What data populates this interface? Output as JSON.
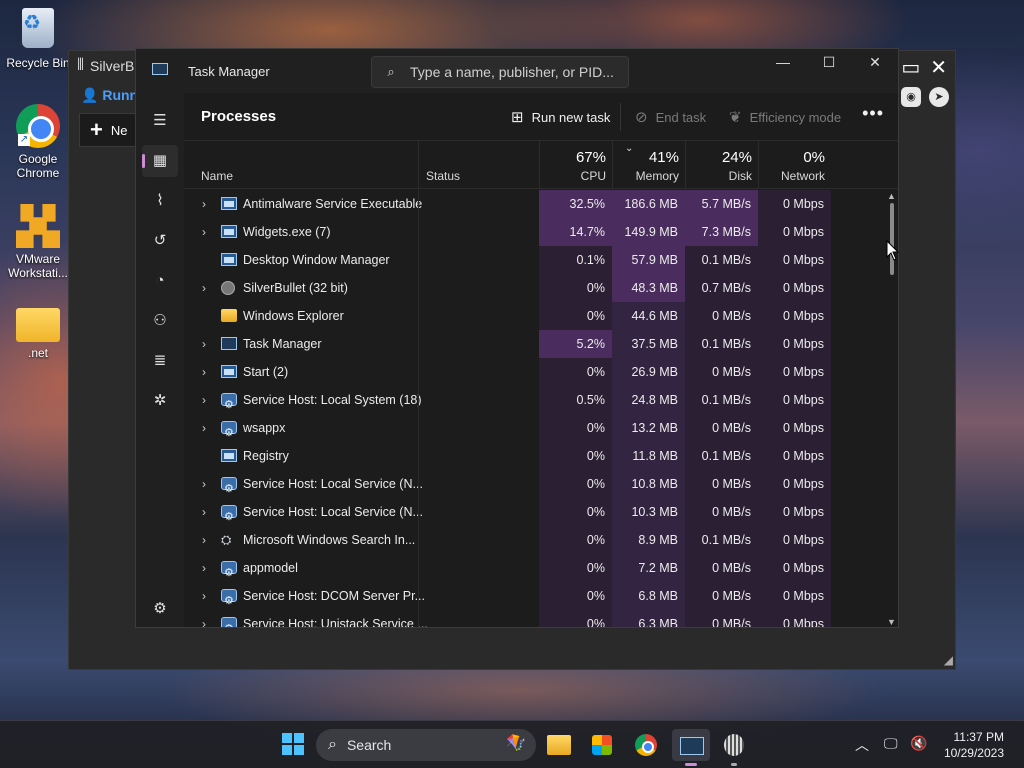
{
  "desktop": {
    "icons": [
      {
        "label": "Recycle Bin",
        "icon": "recycle-bin-icon"
      },
      {
        "label": "Google Chrome",
        "icon": "chrome-icon"
      },
      {
        "label": "VMware Workstati...",
        "icon": "vmware-icon"
      },
      {
        "label": ".net",
        "icon": "folder-icon"
      }
    ]
  },
  "background_window": {
    "title": "SilverB",
    "status_text": "Runn",
    "new_button": "Ne"
  },
  "task_manager": {
    "title": "Task Manager",
    "search_placeholder": "Type a name, publisher, or PID...",
    "page_title": "Processes",
    "commands": {
      "run_new_task": "Run new task",
      "end_task": "End task",
      "efficiency_mode": "Efficiency mode"
    },
    "columns": {
      "name": "Name",
      "status": "Status",
      "cpu": {
        "label": "CPU",
        "percent": "67%"
      },
      "memory": {
        "label": "Memory",
        "percent": "41%"
      },
      "disk": {
        "label": "Disk",
        "percent": "24%"
      },
      "network": {
        "label": "Network",
        "percent": "0%"
      }
    },
    "processes": [
      {
        "name": "Antimalware Service Executable",
        "expandable": true,
        "icon": "app-icon",
        "cpu": "32.5%",
        "memory": "186.6 MB",
        "disk": "5.7 MB/s",
        "network": "0 Mbps",
        "cpu_heat": 3,
        "mem_heat": 3,
        "disk_heat": 3
      },
      {
        "name": "Widgets.exe (7)",
        "expandable": true,
        "icon": "app-icon",
        "cpu": "14.7%",
        "memory": "149.9 MB",
        "disk": "7.3 MB/s",
        "network": "0 Mbps",
        "cpu_heat": 3,
        "mem_heat": 3,
        "disk_heat": 3
      },
      {
        "name": "Desktop Window Manager",
        "expandable": false,
        "icon": "app-icon",
        "cpu": "0.1%",
        "memory": "57.9 MB",
        "disk": "0.1 MB/s",
        "network": "0 Mbps",
        "cpu_heat": 1,
        "mem_heat": 3,
        "disk_heat": 1
      },
      {
        "name": "SilverBullet (32 bit)",
        "expandable": true,
        "icon": "silverbullet-icon",
        "cpu": "0%",
        "memory": "48.3 MB",
        "disk": "0.7 MB/s",
        "network": "0 Mbps",
        "cpu_heat": 1,
        "mem_heat": 3,
        "disk_heat": 1
      },
      {
        "name": "Windows Explorer",
        "expandable": false,
        "icon": "folder-icon",
        "cpu": "0%",
        "memory": "44.6 MB",
        "disk": "0 MB/s",
        "network": "0 Mbps",
        "cpu_heat": 1,
        "mem_heat": 2,
        "disk_heat": 1
      },
      {
        "name": "Task Manager",
        "expandable": true,
        "icon": "task-manager-icon",
        "cpu": "5.2%",
        "memory": "37.5 MB",
        "disk": "0.1 MB/s",
        "network": "0 Mbps",
        "cpu_heat": 3,
        "mem_heat": 2,
        "disk_heat": 1
      },
      {
        "name": "Start (2)",
        "expandable": true,
        "icon": "app-icon",
        "cpu": "0%",
        "memory": "26.9 MB",
        "disk": "0 MB/s",
        "network": "0 Mbps",
        "cpu_heat": 1,
        "mem_heat": 2,
        "disk_heat": 1
      },
      {
        "name": "Service Host: Local System (18)",
        "expandable": true,
        "icon": "gear-icon",
        "cpu": "0.5%",
        "memory": "24.8 MB",
        "disk": "0.1 MB/s",
        "network": "0 Mbps",
        "cpu_heat": 1,
        "mem_heat": 2,
        "disk_heat": 1
      },
      {
        "name": "wsappx",
        "expandable": true,
        "icon": "gear-icon",
        "cpu": "0%",
        "memory": "13.2 MB",
        "disk": "0 MB/s",
        "network": "0 Mbps",
        "cpu_heat": 1,
        "mem_heat": 2,
        "disk_heat": 1
      },
      {
        "name": "Registry",
        "expandable": false,
        "icon": "app-icon",
        "cpu": "0%",
        "memory": "11.8 MB",
        "disk": "0.1 MB/s",
        "network": "0 Mbps",
        "cpu_heat": 1,
        "mem_heat": 2,
        "disk_heat": 1
      },
      {
        "name": "Service Host: Local Service (N...",
        "expandable": true,
        "icon": "gear-icon",
        "cpu": "0%",
        "memory": "10.8 MB",
        "disk": "0 MB/s",
        "network": "0 Mbps",
        "cpu_heat": 1,
        "mem_heat": 2,
        "disk_heat": 1
      },
      {
        "name": "Service Host: Local Service (N...",
        "expandable": true,
        "icon": "gear-icon",
        "cpu": "0%",
        "memory": "10.3 MB",
        "disk": "0 MB/s",
        "network": "0 Mbps",
        "cpu_heat": 1,
        "mem_heat": 2,
        "disk_heat": 1
      },
      {
        "name": "Microsoft Windows Search In...",
        "expandable": true,
        "icon": "search-indexer-icon",
        "cpu": "0%",
        "memory": "8.9 MB",
        "disk": "0.1 MB/s",
        "network": "0 Mbps",
        "cpu_heat": 1,
        "mem_heat": 2,
        "disk_heat": 1
      },
      {
        "name": "appmodel",
        "expandable": true,
        "icon": "gear-icon",
        "cpu": "0%",
        "memory": "7.2 MB",
        "disk": "0 MB/s",
        "network": "0 Mbps",
        "cpu_heat": 1,
        "mem_heat": 2,
        "disk_heat": 1
      },
      {
        "name": "Service Host: DCOM Server Pr...",
        "expandable": true,
        "icon": "gear-icon",
        "cpu": "0%",
        "memory": "6.8 MB",
        "disk": "0 MB/s",
        "network": "0 Mbps",
        "cpu_heat": 1,
        "mem_heat": 2,
        "disk_heat": 1
      },
      {
        "name": "Service Host: Unistack Service ...",
        "expandable": true,
        "icon": "gear-icon",
        "cpu": "0%",
        "memory": "6.3 MB",
        "disk": "0 MB/s",
        "network": "0 Mbps",
        "cpu_heat": 1,
        "mem_heat": 2,
        "disk_heat": 1
      }
    ],
    "heat_colors": {
      "1": "#2a1f33",
      "2": "#332541",
      "3": "#4a2d5e"
    }
  },
  "taskbar": {
    "search_label": "Search",
    "clock_time": "11:37 PM",
    "clock_date": "10/29/2023"
  }
}
